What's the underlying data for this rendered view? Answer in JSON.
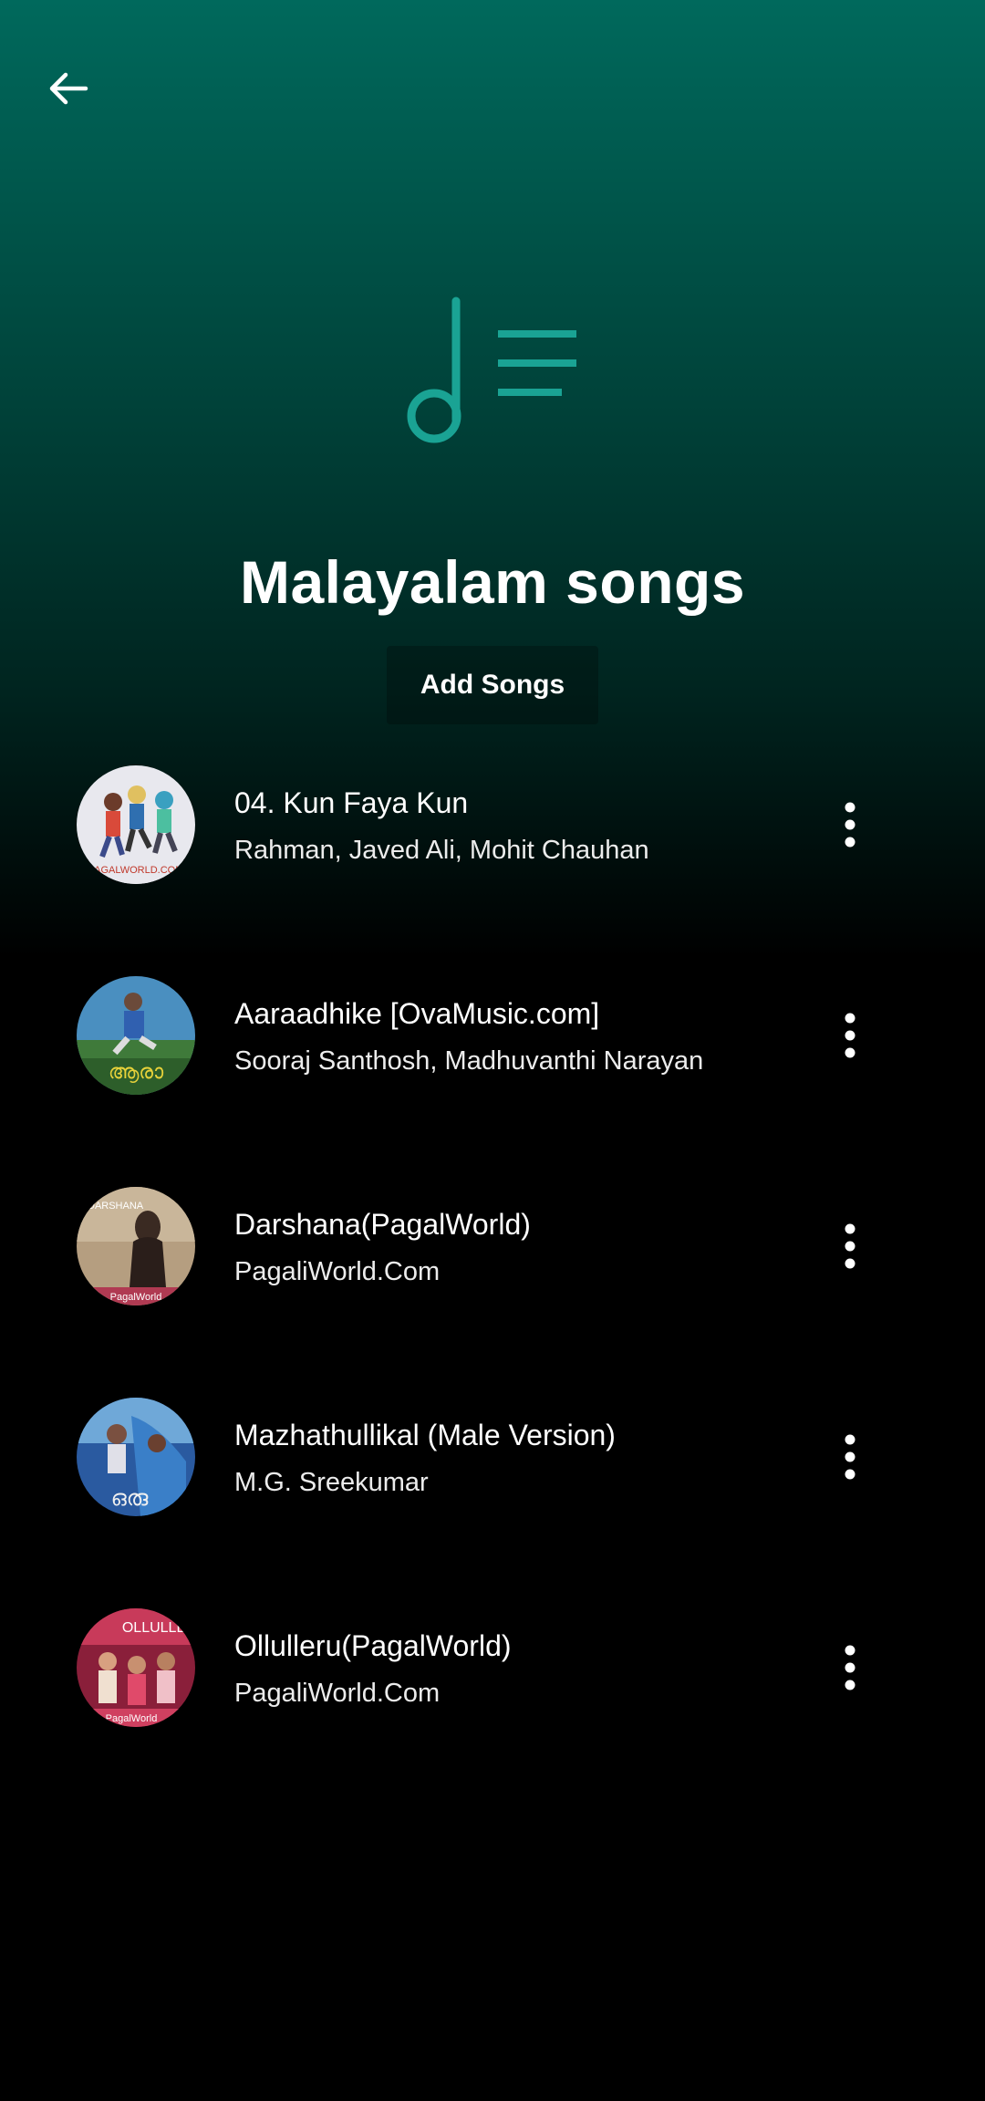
{
  "header": {
    "back_icon": "arrow-left-icon",
    "playlist_icon": "music-note-list-icon",
    "accent_color": "#1aa394"
  },
  "playlist": {
    "title": "Malayalam songs",
    "add_songs_label": "Add Songs"
  },
  "songs": [
    {
      "title": "04. Kun Faya Kun",
      "artist": "Rahman, Javed Ali, Mohit Chauhan",
      "cover_icon": "album-cover-image"
    },
    {
      "title": "Aaraadhike [OvaMusic.com]",
      "artist": "Sooraj Santhosh, Madhuvanthi Narayan",
      "cover_icon": "album-cover-image"
    },
    {
      "title": "Darshana(PagalWorld)",
      "artist": "PagaliWorld.Com",
      "cover_icon": "album-cover-image"
    },
    {
      "title": "Mazhathullikal (Male Version)",
      "artist": "M.G. Sreekumar",
      "cover_icon": "album-cover-image"
    },
    {
      "title": "Ollulleru(PagalWorld)",
      "artist": "PagaliWorld.Com",
      "cover_icon": "album-cover-image"
    }
  ],
  "more_icon": "more-vertical-icon"
}
